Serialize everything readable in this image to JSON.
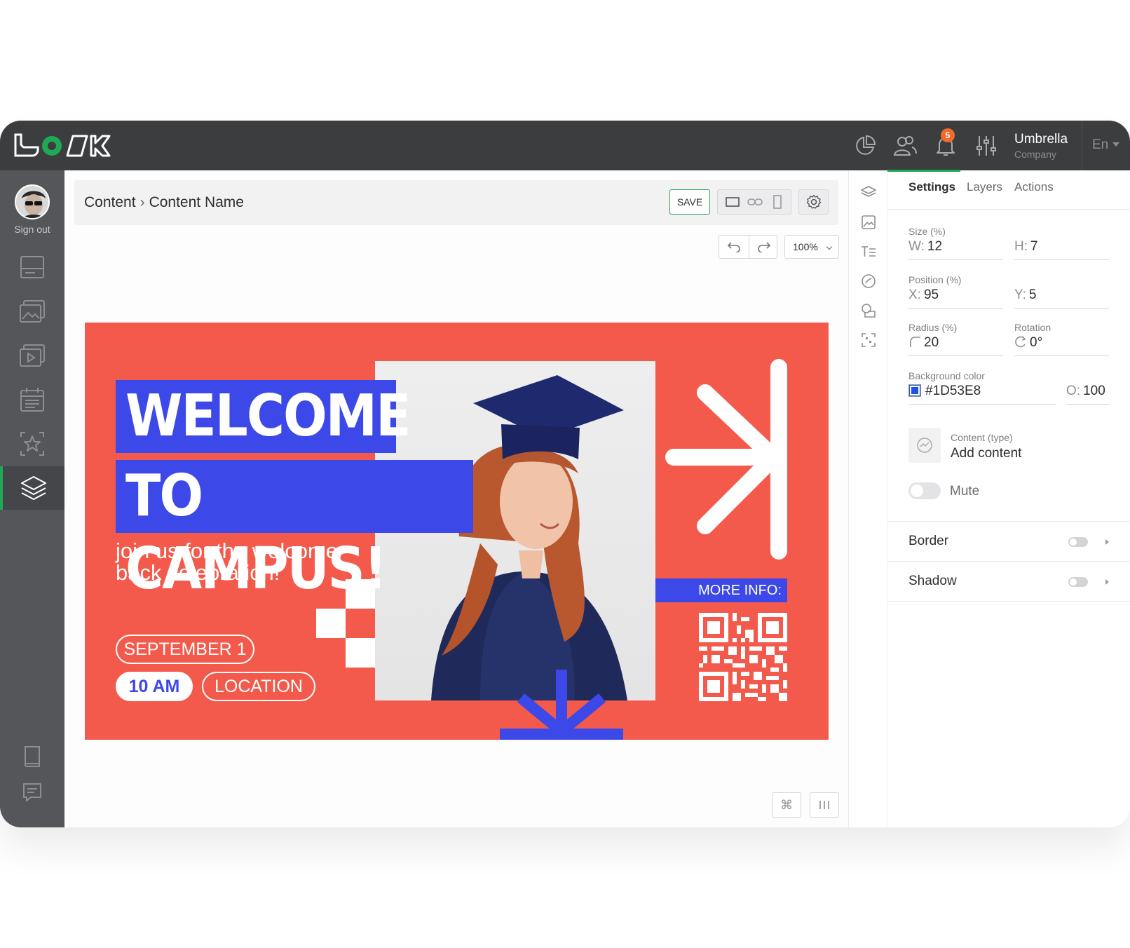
{
  "app": {
    "logo_text": "LOOK"
  },
  "topbar": {
    "notifications_count": "5",
    "company_name": "Umbrella",
    "company_sub": "Company",
    "language": "En",
    "icons": [
      "chart-pie-icon",
      "users-icon",
      "bell-icon",
      "sliders-icon"
    ]
  },
  "sidebar": {
    "sign_out_label": "Sign out",
    "items": [
      "monitor-icon",
      "image-icon",
      "video-icon",
      "calendar-icon",
      "star-frame-icon",
      "layers-icon",
      "book-icon",
      "chat-icon"
    ],
    "active_item": "layers-icon"
  },
  "breadcrumb": {
    "root": "Content",
    "separator": "›",
    "current": "Content Name"
  },
  "toolbar": {
    "save_label": "SAVE",
    "zoom": "100%"
  },
  "poster": {
    "headline_1": "WELCOME",
    "headline_2": "TO CAMPUS!",
    "subtitle": "join us for the welcome back celebration!",
    "date": "SEPTEMBER 1",
    "time": "10 AM",
    "location": "LOCATION",
    "more_info": "MORE INFO:",
    "colors": {
      "background": "#F35A4C",
      "accent": "#3D48E8"
    }
  },
  "panel": {
    "tabs": [
      "Settings",
      "Layers",
      "Actions"
    ],
    "active_tab": "Settings",
    "size_label": "Size (%)",
    "w_prefix": "W:",
    "w_value": "12",
    "h_prefix": "H:",
    "h_value": "7",
    "position_label": "Position (%)",
    "x_prefix": "X:",
    "x_value": "95",
    "y_prefix": "Y:",
    "y_value": "5",
    "radius_label": "Radius (%)",
    "radius_value": "20",
    "rotation_label": "Rotation",
    "rotation_value": "0°",
    "bg_color_label": "Background color",
    "bg_color_value": "#1D53E8",
    "opacity_prefix": "O:",
    "opacity_value": "100",
    "content_type_label": "Content (type)",
    "add_content_label": "Add content",
    "mute_label": "Mute",
    "border_label": "Border",
    "shadow_label": "Shadow"
  },
  "colors": {
    "brand_green": "#1FA956",
    "topbar": "#3C3D3F",
    "sidebar": "#55565A"
  }
}
